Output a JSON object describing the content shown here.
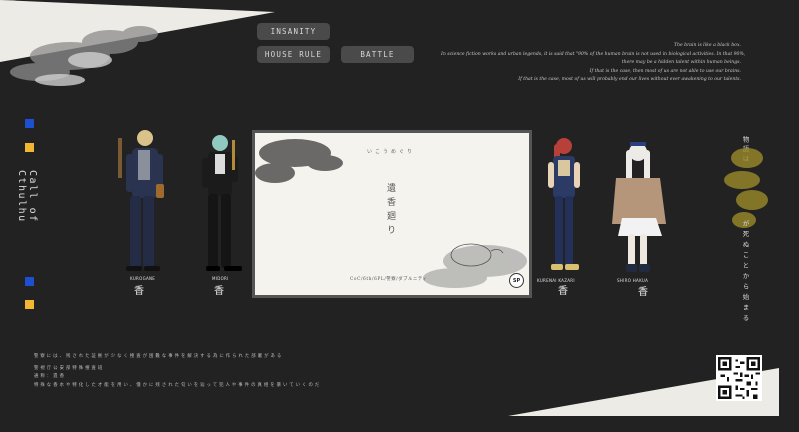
{
  "buttons": {
    "insanity": "INSANITY",
    "house_rule": "HOUSE RULE",
    "battle": "BATTLE",
    "star_icon": "star-icon"
  },
  "intro_lines": [
    "The brain is like a black box.",
    "In science fiction works and urban legends, it is said that \"90% of the human brain is not used in biological activities. In that 90%,",
    "there may be a hidden talent within human beings.",
    "If that is the case, then most of us are not able to use our brains.",
    "If that is the case, most of us will probably end our lives without ever awakening to our talents."
  ],
  "side": {
    "vertical_title": "Call of Cthulhu",
    "colors": {
      "blue": "#1f4fd1",
      "yellow": "#f2b632"
    }
  },
  "card": {
    "subtitle": "いこうめぐり",
    "title": "遺香廻り",
    "meta": "CoC/6th/6PL/警察/ダブルニティ",
    "badge": "SP"
  },
  "right_vertical": {
    "top": "物語は",
    "bottom": "が死ぬことから始まる"
  },
  "bottom_left": {
    "line1": "警察には、残された証拠が少なく捜査が困難な事件を解決する為に作られた部署がある",
    "line2": "警視庁公安部特殊捜査班",
    "line3": "通称：遺香",
    "line4": "特殊な香水や特化した才能を用い、僅かに残された匂いを辿って犯人や事件の真相を暴いていくのだ"
  },
  "characters": [
    {
      "name": "KUROGANE",
      "kanji": "香"
    },
    {
      "name": "MIDORI",
      "kanji": "香"
    },
    {
      "name": "KURENAI KAZARI",
      "kanji": "香"
    },
    {
      "name": "SHIRO HAKUA",
      "kanji": "香"
    }
  ],
  "qr_icon": "qr-code-icon"
}
